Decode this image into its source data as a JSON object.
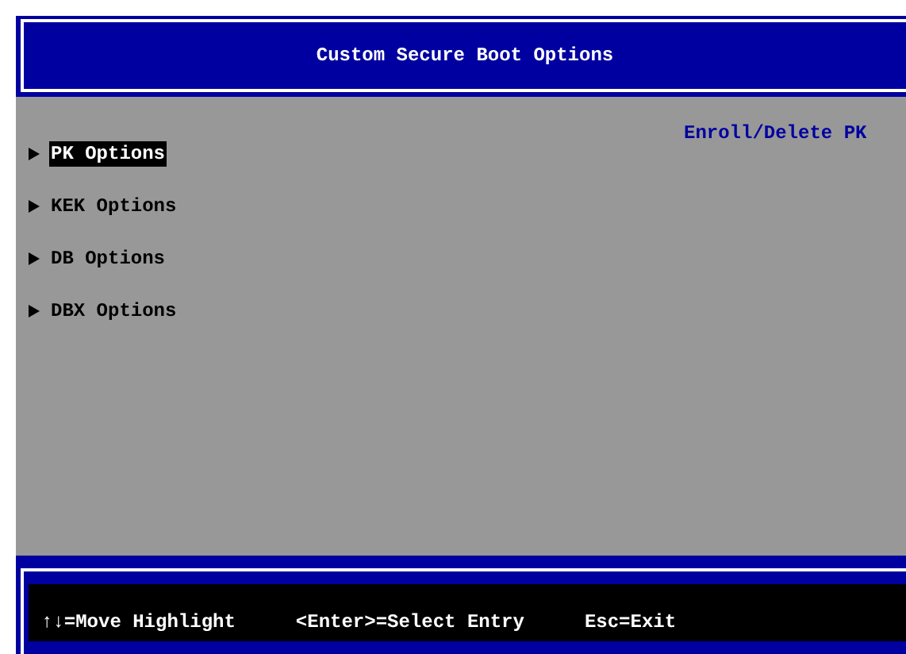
{
  "header": {
    "title": "Custom Secure Boot Options"
  },
  "menu": [
    {
      "label": "PK Options",
      "selected": true
    },
    {
      "label": "KEK Options",
      "selected": false
    },
    {
      "label": "DB Options",
      "selected": false
    },
    {
      "label": "DBX Options",
      "selected": false
    }
  ],
  "help_text": "Enroll/Delete PK",
  "footer": [
    "↑↓=Move Highlight",
    "<Enter>=Select Entry",
    "Esc=Exit"
  ]
}
